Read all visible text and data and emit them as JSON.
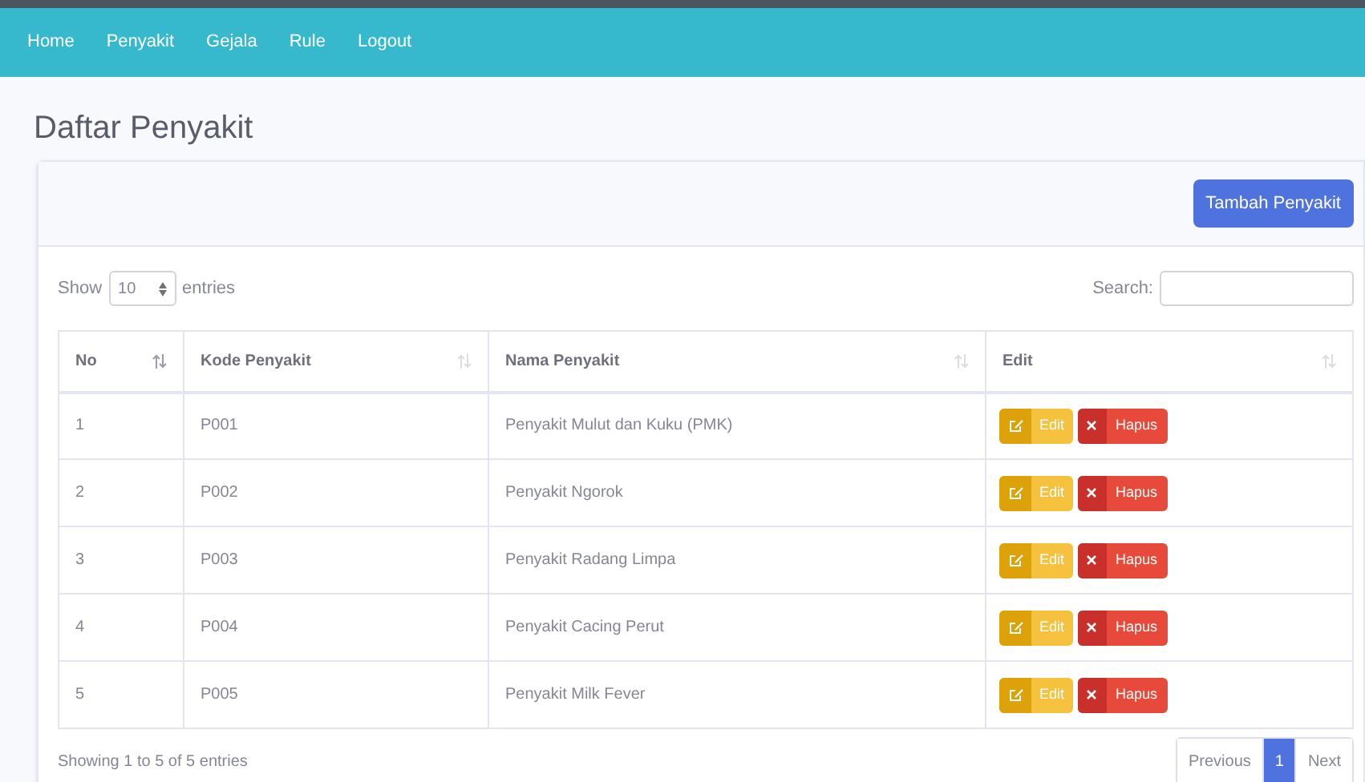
{
  "nav": [
    {
      "label": "Home"
    },
    {
      "label": "Penyakit"
    },
    {
      "label": "Gejala"
    },
    {
      "label": "Rule"
    },
    {
      "label": "Logout"
    }
  ],
  "page_title": "Daftar Penyakit",
  "add_button": "Tambah Penyakit",
  "length_control": {
    "prefix": "Show",
    "value": "10",
    "suffix": "entries"
  },
  "search": {
    "label": "Search:"
  },
  "table": {
    "columns": [
      {
        "label": "No",
        "sorted": true
      },
      {
        "label": "Kode Penyakit",
        "sorted": false
      },
      {
        "label": "Nama Penyakit",
        "sorted": false
      },
      {
        "label": "Edit",
        "sorted": false
      }
    ],
    "rows": [
      {
        "no": "1",
        "code": "P001",
        "name": "Penyakit Mulut dan Kuku (PMK)",
        "edit": "Edit",
        "delete": "Hapus"
      },
      {
        "no": "2",
        "code": "P002",
        "name": "Penyakit Ngorok",
        "edit": "Edit",
        "delete": "Hapus"
      },
      {
        "no": "3",
        "code": "P003",
        "name": "Penyakit Radang Limpa",
        "edit": "Edit",
        "delete": "Hapus"
      },
      {
        "no": "4",
        "code": "P004",
        "name": "Penyakit Cacing Perut",
        "edit": "Edit",
        "delete": "Hapus"
      },
      {
        "no": "5",
        "code": "P005",
        "name": "Penyakit Milk Fever",
        "edit": "Edit",
        "delete": "Hapus"
      }
    ]
  },
  "info": "Showing 1 to 5 of 5 entries",
  "pagination": [
    {
      "label": "Previous",
      "selected": false
    },
    {
      "label": "1",
      "selected": true
    },
    {
      "label": "Next",
      "selected": false
    }
  ]
}
